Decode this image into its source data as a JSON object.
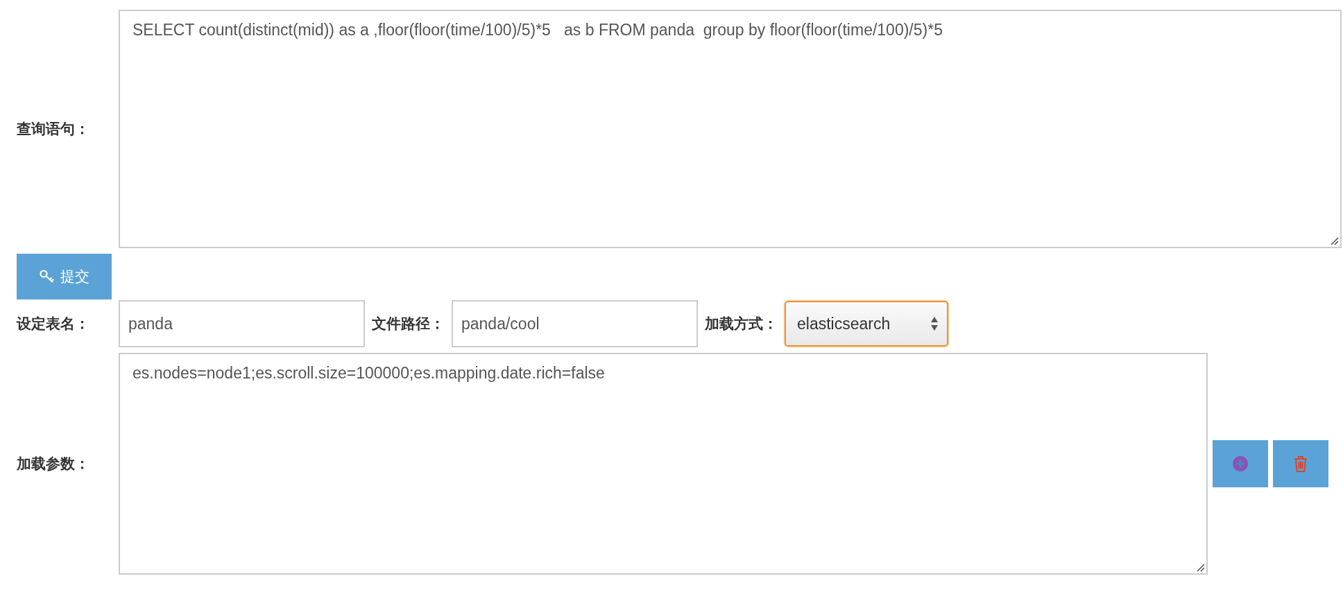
{
  "query": {
    "label": "查询语句：",
    "value": "SELECT count(distinct(mid)) as a ,floor(floor(time/100)/5)*5   as b FROM panda  group by floor(floor(time/100)/5)*5"
  },
  "submit_button": {
    "label": "提交"
  },
  "table_name": {
    "label": "设定表名：",
    "value": "panda"
  },
  "file_path": {
    "label": "文件路径：",
    "value": "panda/cool"
  },
  "load_method": {
    "label": "加载方式：",
    "value": "elasticsearch",
    "focused": true
  },
  "load_params": {
    "label": "加载参数：",
    "value": "es.nodes=node1;es.scroll.size=100000;es.mapping.date.rich=false"
  },
  "param_actions": [
    {
      "kind": "add"
    },
    {
      "kind": "delete"
    }
  ]
}
